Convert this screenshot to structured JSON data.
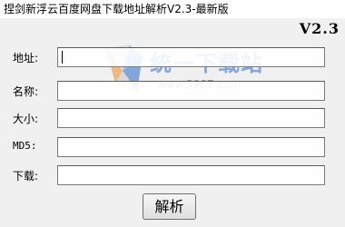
{
  "window": {
    "title": "捏剑新浮云百度网盘下载地址解析V2.3-最新版"
  },
  "version_label": "V2.3",
  "watermark": {
    "brand_text": "统一下载站",
    "url_text": "www.3987.com"
  },
  "form": {
    "fields": [
      {
        "label": "地址:",
        "value": "",
        "placeholder": ""
      },
      {
        "label": "名称:",
        "value": "",
        "placeholder": ""
      },
      {
        "label": "大小:",
        "value": "",
        "placeholder": ""
      },
      {
        "label": "MD5:",
        "value": "",
        "placeholder": ""
      },
      {
        "label": "下载:",
        "value": "",
        "placeholder": ""
      }
    ]
  },
  "parse_button": {
    "label": "解析"
  },
  "colors": {
    "window_background": "#f0f0f0",
    "watermark_blue": "#2a6bc9"
  }
}
